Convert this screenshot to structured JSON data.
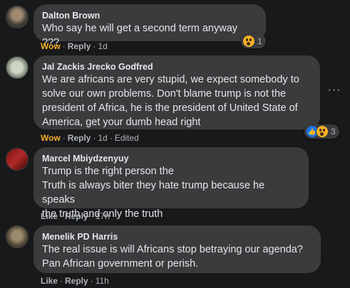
{
  "comments": [
    {
      "author": "Dalton Brown",
      "text": "Who say he will get a second term anyway ???",
      "reaction_label": "Wow",
      "reply_label": "Reply",
      "time": "1d",
      "reaction_count": "1"
    },
    {
      "author": "Jal Zackis Jrecko Godfred",
      "text": "We are africans are very stupid, we expect somebody to\nsolve our own problems. Don't blame trump is not the\npresident of Africa, he is the president of United State of\nAmerica, get your dumb head right",
      "reaction_label": "Wow",
      "reply_label": "Reply",
      "time": "1d",
      "edited": "Edited",
      "reaction_count": "3"
    },
    {
      "author": "Marcel Mbiydzenyuy",
      "text": "Trump is the right person the\nTruth is always biter they hate trump because he speaks\nthe truth and only the truth",
      "reaction_label": "Like",
      "reply_label": "Reply",
      "time": "17h"
    },
    {
      "author": "Menelik PD Harris",
      "text": "The real issue is will Africans stop betraying our agenda?\nPan African government or perish.",
      "reaction_label": "Like",
      "reply_label": "Reply",
      "time": "11h"
    }
  ],
  "more_options": "···",
  "colors": {
    "background": "#18191a",
    "bubble": "#3a3b3c",
    "wow": "#f7b125",
    "muted": "#b0b3b8"
  }
}
